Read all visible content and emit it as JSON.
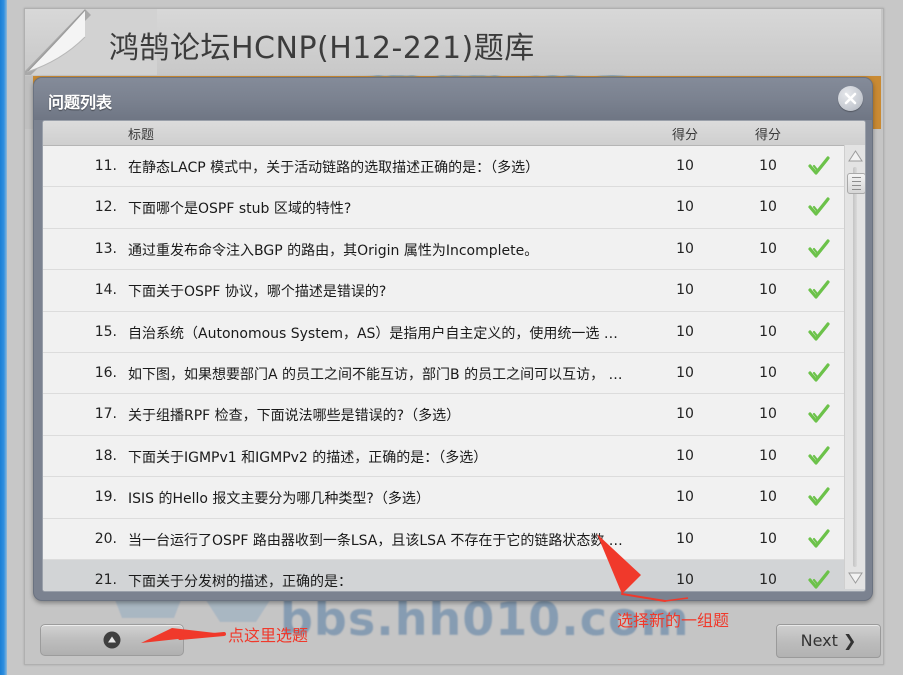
{
  "page": {
    "header_title": "鸿鹄论坛HCNP(H12-221)题库",
    "watermark_top": "鸿鹄论坛",
    "watermark_bottom": "bbs.hh010.com"
  },
  "dialog": {
    "title": "问题列表",
    "close_icon": "close-icon",
    "columns": {
      "number": "",
      "title": "标题",
      "score1": "得分",
      "score2": "得分",
      "status": ""
    },
    "rows": [
      {
        "num": "11.",
        "title": "在静态LACP 模式中，关于活动链路的选取描述正确的是：（多选）",
        "score1": "10",
        "score2": "10",
        "status": "check-icon",
        "selected": false
      },
      {
        "num": "12.",
        "title": "下面哪个是OSPF stub 区域的特性?",
        "score1": "10",
        "score2": "10",
        "status": "check-icon",
        "selected": false
      },
      {
        "num": "13.",
        "title": "通过重发布命令注入BGP 的路由，其Origin 属性为Incomplete。",
        "score1": "10",
        "score2": "10",
        "status": "check-icon",
        "selected": false
      },
      {
        "num": "14.",
        "title": "下面关于OSPF 协议，哪个描述是错误的?",
        "score1": "10",
        "score2": "10",
        "status": "check-icon",
        "selected": false
      },
      {
        "num": "15.",
        "title": "自治系统（Autonomous System，AS）是指用户自主定义的，使用统一选 …",
        "score1": "10",
        "score2": "10",
        "status": "check-icon",
        "selected": false
      },
      {
        "num": "16.",
        "title": "如下图，如果想要部门A 的员工之间不能互访，部门B 的员工之间可以互访， …",
        "score1": "10",
        "score2": "10",
        "status": "check-icon",
        "selected": false
      },
      {
        "num": "17.",
        "title": "关于组播RPF 检查，下面说法哪些是错误的?（多选）",
        "score1": "10",
        "score2": "10",
        "status": "check-icon",
        "selected": false
      },
      {
        "num": "18.",
        "title": "下面关于IGMPv1 和IGMPv2 的描述，正确的是：（多选）",
        "score1": "10",
        "score2": "10",
        "status": "check-icon",
        "selected": false
      },
      {
        "num": "19.",
        "title": "ISIS 的Hello 报文主要分为哪几种类型?（多选）",
        "score1": "10",
        "score2": "10",
        "status": "check-icon",
        "selected": false
      },
      {
        "num": "20.",
        "title": "当一台运行了OSPF 路由器收到一条LSA，且该LSA 不存在于它的链路状态数 …",
        "score1": "10",
        "score2": "10",
        "status": "check-icon",
        "selected": false
      },
      {
        "num": "21.",
        "title": "下面关于分发树的描述，正确的是：",
        "score1": "10",
        "score2": "10",
        "status": "check-icon",
        "selected": true
      }
    ],
    "scrollbar": {
      "up_icon": "triangle-up-icon",
      "down_icon": "triangle-down-icon",
      "thumb_icon": "scroll-thumb"
    }
  },
  "footer": {
    "select_button_icon": "triangle-up-circle-icon",
    "next_label": "Next ❯"
  },
  "annotations": [
    {
      "text": "点这里选题"
    },
    {
      "text": "选择新的一组题"
    }
  ],
  "colors": {
    "accent_orange": "#c98a33",
    "dialog_chrome": "#7b8290",
    "annotation_red": "#f0392b",
    "check_green": "#6cc24a",
    "browser_edge_blue": "#2f8fe0"
  }
}
